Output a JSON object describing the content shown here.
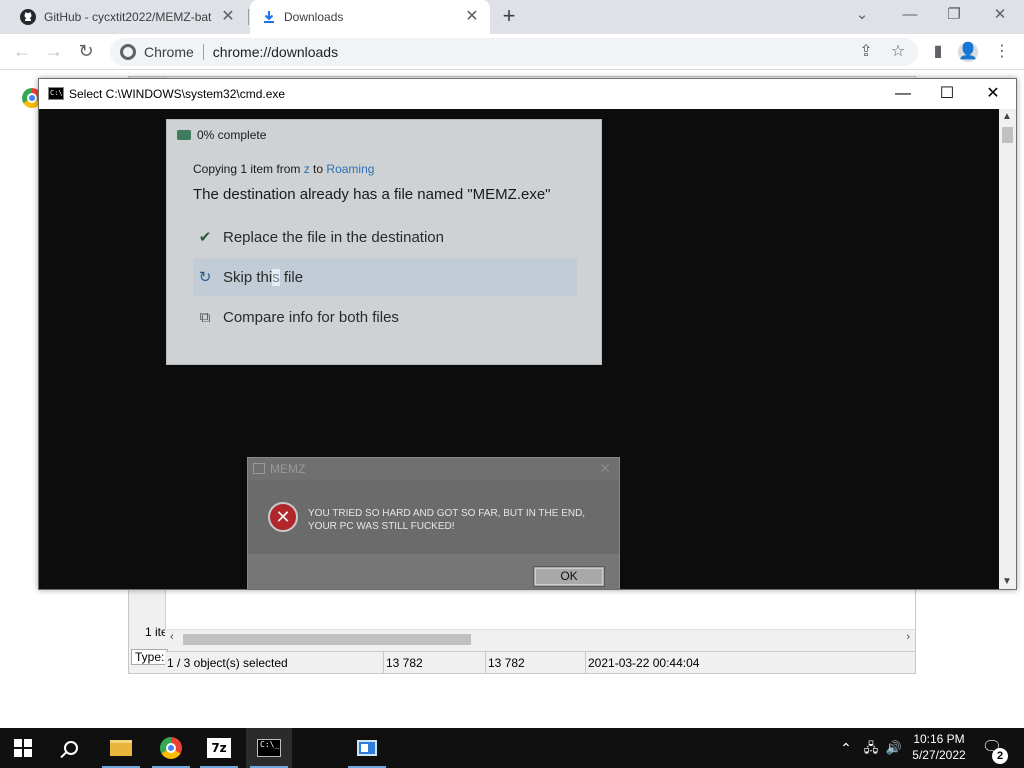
{
  "browser": {
    "tabs": [
      {
        "title": "GitHub - cycxtit2022/MEMZ-bat",
        "icon": "github-icon"
      },
      {
        "title": "Downloads",
        "icon": "download-icon"
      }
    ],
    "new_tab_label": "+",
    "omnibox": {
      "site_label": "Chrome",
      "url": "chrome://downloads"
    }
  },
  "zip_window": {
    "left_count": "1 ite",
    "left_type": "Type: ",
    "status": {
      "selected": "1 / 3 object(s) selected",
      "size": "13 782",
      "packed": "13 782",
      "modified": "2021-03-22 00:44:04"
    }
  },
  "cmd_window": {
    "title": "Select C:\\WINDOWS\\system32\\cmd.exe",
    "icon_text": "C:\\"
  },
  "copy_dialog": {
    "header": "0% complete",
    "line1_prefix": "Copying 1 item from ",
    "line1_source": "z",
    "line1_mid": " to ",
    "line1_dest": "Roaming",
    "line2": "The destination already has a file named \"MEMZ.exe\"",
    "options": [
      {
        "label": "Replace the file in the destination",
        "icon": "checkmark-icon"
      },
      {
        "label_before": "Skip thi",
        "label_highlight": "s",
        "label_after": " file",
        "icon": "skip-arrow-icon"
      },
      {
        "label": "Compare info for both files",
        "icon": "compare-icon"
      }
    ]
  },
  "memz_dialog": {
    "title": "MEMZ",
    "message_line1": "YOU TRIED SO HARD AND GOT SO FAR, BUT IN THE END,",
    "message_line2": "YOUR PC WAS STILL FUCKED!",
    "ok_label": "OK",
    "error_glyph": "✕"
  },
  "taskbar": {
    "apps": [
      "start",
      "search",
      "file-explorer",
      "chrome",
      "7-zip",
      "cmd",
      "app"
    ],
    "sevenzip_label": "7z",
    "cmd_icon_text": "C:\\_",
    "time": "10:16 PM",
    "date": "5/27/2022",
    "notification_count": "2"
  }
}
